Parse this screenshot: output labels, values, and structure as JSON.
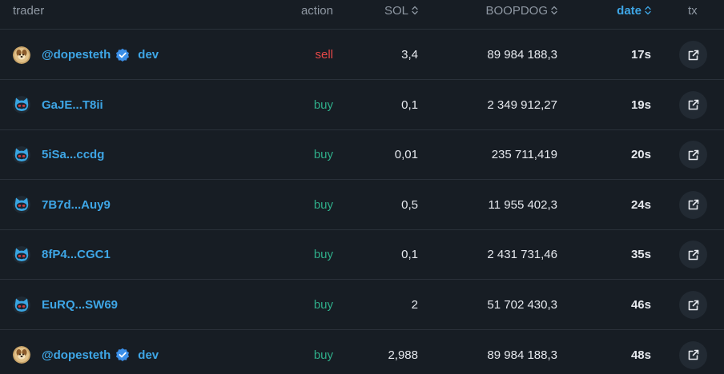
{
  "header": {
    "trader": "trader",
    "action": "action",
    "sol": "SOL",
    "token": "BOOPDOG",
    "date": "date",
    "tx": "tx"
  },
  "colors": {
    "background": "#171d24",
    "accent": "#3ea6e6",
    "sell": "#e64848",
    "buy": "#2fae8a"
  },
  "rows": [
    {
      "trader": "@dopesteth",
      "avatar": "dog-avatar-icon",
      "verified": true,
      "dev": "dev",
      "action": "sell",
      "sol": "3,4",
      "token": "89 984 188,3",
      "date": "17s"
    },
    {
      "trader": "GaJE...T8ii",
      "avatar": "cat-avatar-icon",
      "verified": false,
      "dev": "",
      "action": "buy",
      "sol": "0,1",
      "token": "2 349 912,27",
      "date": "19s"
    },
    {
      "trader": "5iSa...ccdg",
      "avatar": "cat-avatar-icon",
      "verified": false,
      "dev": "",
      "action": "buy",
      "sol": "0,01",
      "token": "235 711,419",
      "date": "20s"
    },
    {
      "trader": "7B7d...Auy9",
      "avatar": "cat-avatar-icon",
      "verified": false,
      "dev": "",
      "action": "buy",
      "sol": "0,5",
      "token": "11 955 402,3",
      "date": "24s"
    },
    {
      "trader": "8fP4...CGC1",
      "avatar": "cat-avatar-icon",
      "verified": false,
      "dev": "",
      "action": "buy",
      "sol": "0,1",
      "token": "2 431 731,46",
      "date": "35s"
    },
    {
      "trader": "EuRQ...SW69",
      "avatar": "cat-avatar-icon",
      "verified": false,
      "dev": "",
      "action": "buy",
      "sol": "2",
      "token": "51 702 430,3",
      "date": "46s"
    },
    {
      "trader": "@dopesteth",
      "avatar": "dog-avatar-icon",
      "verified": true,
      "dev": "dev",
      "action": "buy",
      "sol": "2,988",
      "token": "89 984 188,3",
      "date": "48s"
    }
  ]
}
